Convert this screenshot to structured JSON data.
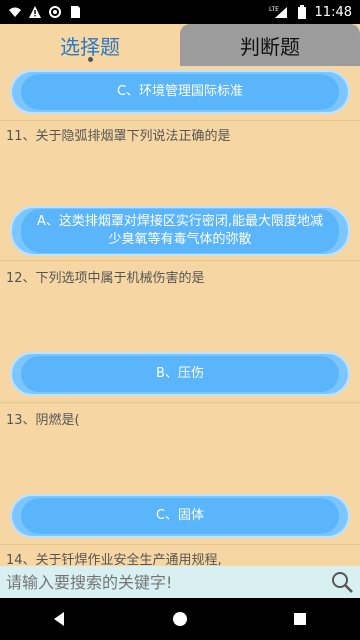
{
  "status_bar": {
    "time": "11:48",
    "network": "LTE",
    "icons": [
      "wifi-icon",
      "alert-icon",
      "circle-icon",
      "sd-icon",
      "signal-icon",
      "battery-icon"
    ]
  },
  "tabs": {
    "active_label": "选择题",
    "inactive_label": "判断题"
  },
  "questions": [
    {
      "text": "",
      "answer": "C、环境管理国际标准"
    },
    {
      "text": "11、关于隐弧排烟罩下列说法正确的是",
      "answer": "A、这类排烟罩对焊接区实行密闭,能最大限度地减少臭氧等有毒气体的弥散"
    },
    {
      "text": "12、下列选项中属于机械伤害的是",
      "answer": "B、压伤"
    },
    {
      "text": "13、阴燃是(",
      "answer": "C、固体"
    },
    {
      "text": "14、关于钎焊作业安全生产通用规程,",
      "answer": ""
    }
  ],
  "search": {
    "placeholder": "请输入要搜索的关键字!"
  },
  "colors": {
    "background": "#f6d7a3",
    "accent": "#2a79c6",
    "pill": "#5bb5fb"
  }
}
